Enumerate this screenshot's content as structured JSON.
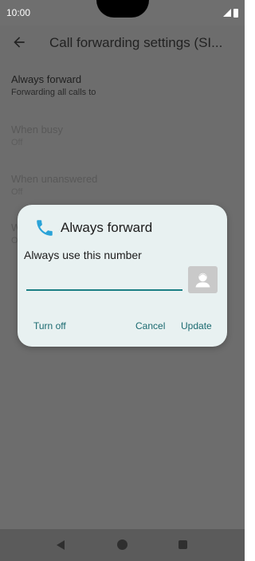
{
  "status_bar": {
    "time": "10:00"
  },
  "app_bar": {
    "title": "Call forwarding settings (SI..."
  },
  "list": [
    {
      "title": "Always forward",
      "subtitle": "Forwarding all calls to"
    },
    {
      "title": "When busy",
      "subtitle": "Off"
    },
    {
      "title": "When unanswered",
      "subtitle": "Off"
    },
    {
      "title": "W",
      "subtitle": "O"
    }
  ],
  "dialog": {
    "title": "Always forward",
    "label": "Always use this number",
    "input_value": "",
    "buttons": {
      "turn_off": "Turn off",
      "cancel": "Cancel",
      "update": "Update"
    }
  },
  "colors": {
    "accent": "#1a7f84",
    "phone_icon": "#2aa3d8",
    "dialog_bg": "#e8f1f1"
  }
}
